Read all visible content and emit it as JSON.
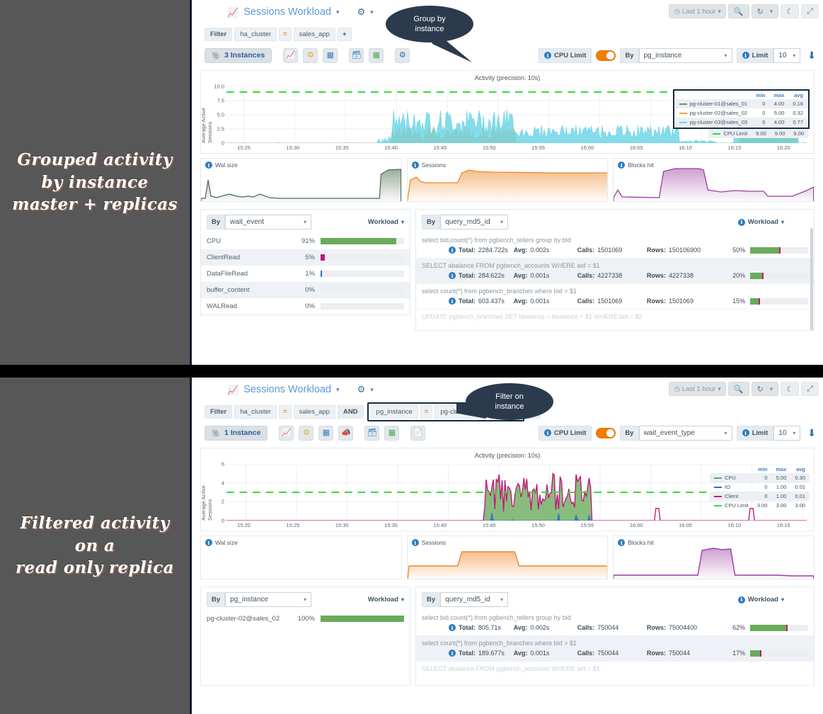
{
  "panels": [
    {
      "caption": "Grouped activity\nby instance\nmaster + replicas",
      "header": {
        "title": "Sessions Workload",
        "brand_icon": "chart-area-icon",
        "gear_icon": "gear-icon"
      },
      "topright": {
        "time_range": "Last 1 hour",
        "search_icon": "search-icon",
        "refresh_icon": "refresh-icon",
        "theme_icon": "moon-icon",
        "fullscreen_icon": "fullscreen-icon"
      },
      "filter": {
        "label": "Filter",
        "chips": [
          {
            "key": "ha_cluster",
            "op": "=",
            "value": "sales_app"
          }
        ],
        "add_label": "+",
        "highlighted": false
      },
      "instances": {
        "label": "3 Instances",
        "icon": "postgres-elephant-icon"
      },
      "icon_buttons": [
        "activity-chart-icon",
        "settings-gear-icon",
        "table-grid-icon",
        "database-icon",
        "green-table-icon",
        "dashboard-icon"
      ],
      "controls": {
        "cpu_limit_label": "CPU Limit",
        "cpu_limit_on": true,
        "by_label": "By",
        "by_value": "pg_instance",
        "limit_label": "Limit",
        "limit_value": "10",
        "download_icon": "download-icon"
      },
      "callout": {
        "text": "Group by\ninstance"
      },
      "chart_data": {
        "type": "area",
        "title": "Activity (precision: 10s)",
        "xlabel": "",
        "ylabel": "Average Active Sessions",
        "ylim": [
          0,
          10
        ],
        "yticks": [
          "0",
          "2.5",
          "5.0",
          "7.5",
          "10.0"
        ],
        "xticks": [
          "15:25",
          "15:30",
          "15:35",
          "15:40",
          "15:45",
          "15:50",
          "15:55",
          "16:00",
          "16:05",
          "16:10",
          "16:15",
          "16:20"
        ],
        "grid": true,
        "legend_position": "right",
        "threshold": {
          "name": "CPU Limit",
          "value": 9.0,
          "color": "#33dd33",
          "style": "dashed"
        },
        "legend_headers": [
          "min",
          "max",
          "avg"
        ],
        "series": [
          {
            "name": "pg-cluster-01@sales_01",
            "color": "#6a9a5b",
            "min": "0",
            "max": "4.00",
            "avg": "0.16"
          },
          {
            "name": "pg-cluster-02@sales_02",
            "color": "#f0a330",
            "min": "0",
            "max": "5.00",
            "avg": "0.32"
          },
          {
            "name": "pg-cluster-03@sales_03",
            "color": "#6fd6e8",
            "min": "0",
            "max": "4.00",
            "avg": "0.77"
          },
          {
            "name": "CPU Limit",
            "color": "#33dd33",
            "min": "9.00",
            "max": "9.00",
            "avg": "9.00"
          }
        ]
      },
      "mini_charts": [
        {
          "title": "Wal size",
          "color": "#4a6b4a",
          "shape": "wal-top"
        },
        {
          "title": "Sessions",
          "color": "#f0882a",
          "shape": "sessions-top"
        },
        {
          "title": "Blocks hit",
          "color": "#9b3fa0",
          "shape": "blocks-top"
        }
      ],
      "left_table": {
        "by_label": "By",
        "by_value": "wait_event",
        "workload_label": "Workload",
        "rows": [
          {
            "name": "CPU",
            "pct": "91%",
            "value": 91,
            "color": "#6aab5c"
          },
          {
            "name": "ClientRead",
            "pct": "5%",
            "value": 5,
            "color": "#c2177a"
          },
          {
            "name": "DataFileRead",
            "pct": "1%",
            "value": 1,
            "color": "#2f6fd0"
          },
          {
            "name": "buffer_content",
            "pct": "0%",
            "value": 0,
            "color": "#7a7a7a"
          },
          {
            "name": "WALRead",
            "pct": "0%",
            "value": 0,
            "color": "#7a7a7a"
          }
        ]
      },
      "right_table": {
        "by_label": "By",
        "by_value": "query_md5_id",
        "workload_label": "Workload",
        "col_labels": {
          "total": "Total:",
          "avg": "Avg:",
          "calls": "Calls:",
          "rows": "Rows:"
        },
        "queries": [
          {
            "sql": "select bid,count(*) from pgbench_tellers group by bid",
            "total": "2284.722s",
            "avg": "0.002s",
            "calls": "1501069",
            "rows": "150106900",
            "pct": "50%",
            "value": 50
          },
          {
            "sql": "SELECT abalance FROM pgbench_accounts WHERE aid = $1",
            "total": "284.622s",
            "avg": "0.001s",
            "calls": "4227338",
            "rows": "4227338",
            "pct": "20%",
            "value": 20
          },
          {
            "sql": "select count(*) from pgbench_branches where bid > $1",
            "total": "603.437s",
            "avg": "0.001s",
            "calls": "1501069",
            "rows": "1501069",
            "pct": "15%",
            "value": 15
          }
        ],
        "cut_off_sql": "UPDATE pgbench_branches SET bbalance = bbalance + $1 WHERE bid = $2"
      }
    },
    {
      "caption": "Filtered activity\non a\nread only replica",
      "header": {
        "title": "Sessions Workload",
        "brand_icon": "chart-area-icon",
        "gear_icon": "gear-icon"
      },
      "topright": {
        "time_range": "Last 1 hour",
        "search_icon": "search-icon",
        "refresh_icon": "refresh-icon",
        "theme_icon": "moon-icon",
        "fullscreen_icon": "fullscreen-icon"
      },
      "filter": {
        "label": "Filter",
        "chips": [
          {
            "key": "ha_cluster",
            "op": "=",
            "value": "sales_app"
          }
        ],
        "and_label": "AND",
        "highlighted_chip": {
          "key": "pg_instance",
          "op": "=",
          "value": "pg-cluster-02@sales_02"
        },
        "add_label": "+",
        "highlighted": true
      },
      "instances": {
        "label": "1 Instance",
        "icon": "postgres-elephant-icon"
      },
      "icon_buttons": [
        "activity-chart-icon",
        "settings-gear-icon",
        "table-grid-icon",
        "megaphone-icon",
        "database-icon",
        "green-table-icon",
        "pdf-file-icon"
      ],
      "controls": {
        "cpu_limit_label": "CPU Limit",
        "cpu_limit_on": true,
        "by_label": "By",
        "by_value": "wait_event_type",
        "limit_label": "Limit",
        "limit_value": "10",
        "download_icon": "download-icon"
      },
      "callout": {
        "text": "Filter on\ninstance"
      },
      "chart_data": {
        "type": "area",
        "title": "Activity (precision: 10s)",
        "xlabel": "",
        "ylabel": "Average Active Sessions",
        "ylim": [
          0,
          6
        ],
        "yticks": [
          "0",
          "2",
          "4",
          "6"
        ],
        "xticks": [
          "15:20",
          "15:25",
          "15:30",
          "15:35",
          "15:40",
          "15:45",
          "15:50",
          "15:55",
          "16:00",
          "16:05",
          "16:10",
          "16:15"
        ],
        "grid": true,
        "legend_position": "right",
        "threshold": {
          "name": "CPU Limit",
          "value": 3.0,
          "color": "#33dd33",
          "style": "dashed"
        },
        "legend_headers": [
          "min",
          "max",
          "avg"
        ],
        "series": [
          {
            "name": "CPU",
            "color": "#6aab5c",
            "min": "0",
            "max": "5.00",
            "avg": "0.30"
          },
          {
            "name": "IO",
            "color": "#2f6fd0",
            "min": "0",
            "max": "1.00",
            "avg": "0.01"
          },
          {
            "name": "Client",
            "color": "#c2177a",
            "min": "0",
            "max": "1.00",
            "avg": "0.01"
          },
          {
            "name": "CPU Limit",
            "color": "#33dd33",
            "min": "3.00",
            "max": "3.00",
            "avg": "3.00"
          }
        ]
      },
      "mini_charts": [
        {
          "title": "Wal size",
          "color": "#4a6b4a",
          "shape": "wal-bottom"
        },
        {
          "title": "Sessions",
          "color": "#f0882a",
          "shape": "sessions-bottom"
        },
        {
          "title": "Blocks hit",
          "color": "#9b3fa0",
          "shape": "blocks-bottom"
        }
      ],
      "left_table": {
        "by_label": "By",
        "by_value": "pg_instance",
        "workload_label": "Workload",
        "rows": [
          {
            "name": "pg-cluster-02@sales_02",
            "pct": "100%",
            "value": 100,
            "color": "#6aab5c"
          }
        ]
      },
      "right_table": {
        "by_label": "By",
        "by_value": "query_md5_id",
        "workload_label": "Workload",
        "col_labels": {
          "total": "Total:",
          "avg": "Avg:",
          "calls": "Calls:",
          "rows": "Rows:"
        },
        "queries": [
          {
            "sql": "select bid,count(*) from pgbench_tellers group by bid",
            "total": "805.71s",
            "avg": "0.002s",
            "calls": "750044",
            "rows": "75004400",
            "pct": "62%",
            "value": 62
          },
          {
            "sql": "select count(*) from pgbench_branches where bid > $1",
            "total": "189.677s",
            "avg": "0.001s",
            "calls": "750044",
            "rows": "750044",
            "pct": "17%",
            "value": 17
          }
        ],
        "cut_off_sql": "SELECT abalance FROM pgbench_accounts WHERE aid = $1"
      }
    }
  ]
}
